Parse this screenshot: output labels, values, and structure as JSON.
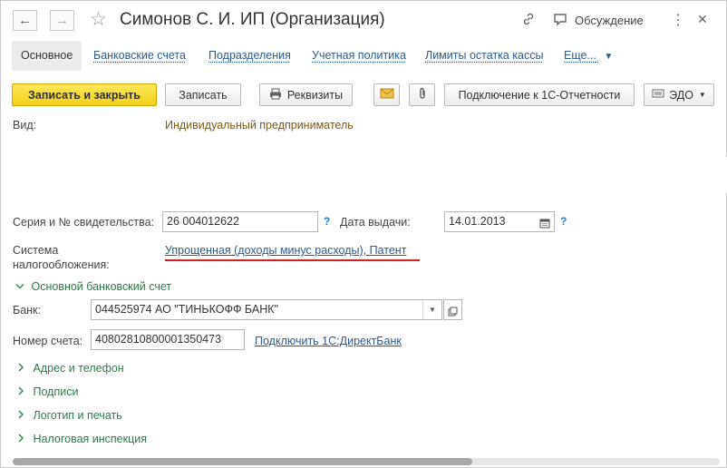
{
  "window": {
    "title": "Симонов С. И. ИП (Организация)",
    "discussion_label": "Обсуждение"
  },
  "icons": {
    "back": "arrow-left-icon",
    "forward": "arrow-right-icon",
    "favorite": "star-icon",
    "link": "link-icon",
    "discussion": "speech-bubble-icon",
    "more": "more-vertical-icon",
    "close": "close-icon"
  },
  "tabs": [
    {
      "label": "Основное",
      "active": true
    },
    {
      "label": "Банковские счета"
    },
    {
      "label": "Подразделения"
    },
    {
      "label": "Учетная политика"
    },
    {
      "label": "Лимиты остатка кассы"
    },
    {
      "label": "Еще..."
    }
  ],
  "toolbar": {
    "save_close": "Записать и закрыть",
    "save": "Записать",
    "details": "Реквизиты",
    "connect": "Подключение к 1С-Отчетности",
    "edo": "ЭДО"
  },
  "form": {
    "kind_label": "Вид:",
    "kind_value": "Индивидуальный предприниматель",
    "cert_label": "Серия и № свидетельства:",
    "cert_value": "26 004012622",
    "help": "?",
    "issue_date_label": "Дата выдачи:",
    "issue_date_value": "14.01.2013",
    "tax_label_1": "Система",
    "tax_label_2": "налогообложения:",
    "tax_value": "Упрощенная (доходы минус расходы), Патент",
    "bank_section": "Основной банковский счет",
    "bank_label": "Банк:",
    "bank_value": "044525974 АО \"ТИНЬКОФФ БАНК\"",
    "account_label": "Номер счета:",
    "account_value": "40802810800001350473",
    "directbank_link": "Подключить 1С:ДиректБанк"
  },
  "sections": [
    {
      "label": "Адрес и телефон"
    },
    {
      "label": "Подписи"
    },
    {
      "label": "Логотип и печать"
    },
    {
      "label": "Налоговая инспекция"
    }
  ],
  "scrollbar": {
    "position_fraction": 0.65
  },
  "colors": {
    "accent_yellow": "#f3cf18",
    "link_blue": "#2d5a8c",
    "section_green": "#2e7a4a",
    "underline_red": "#d42020"
  }
}
